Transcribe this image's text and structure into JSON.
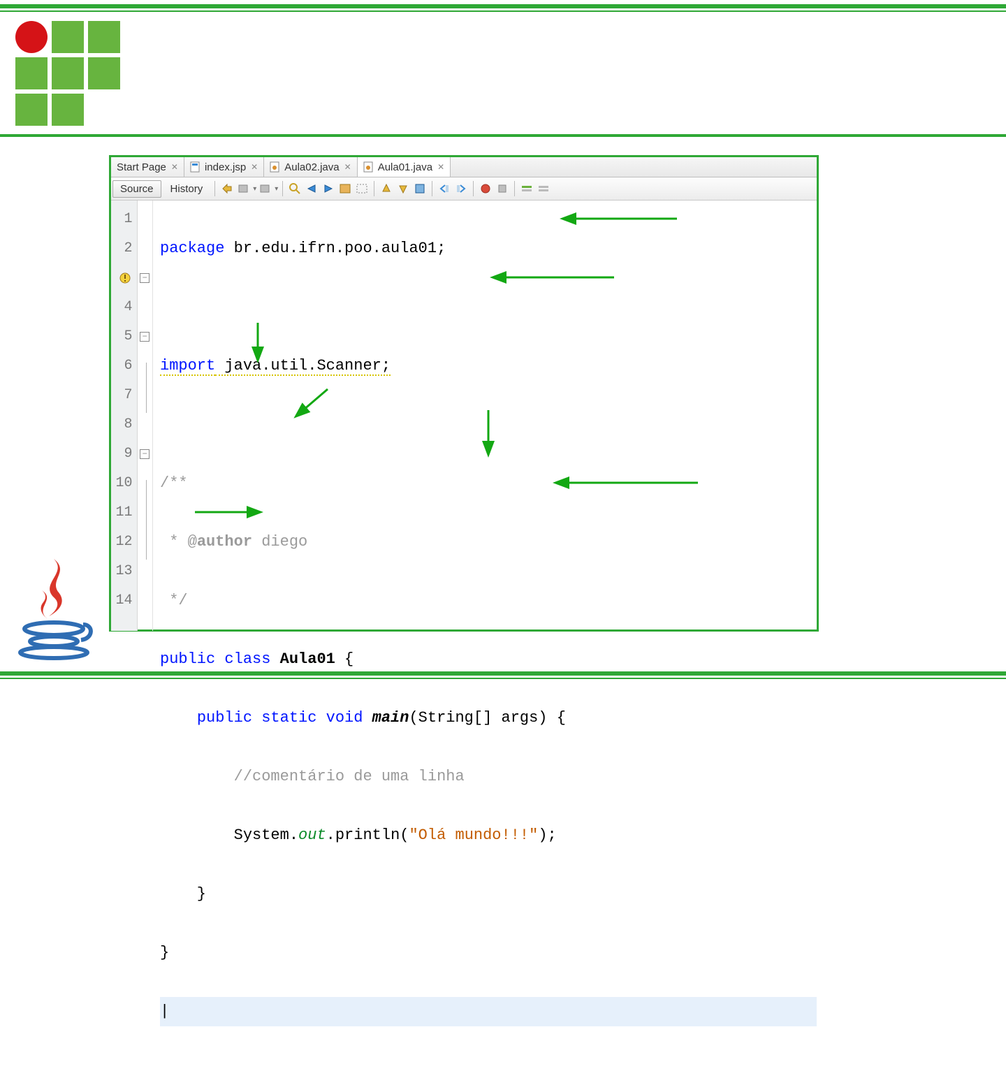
{
  "tabs": [
    {
      "label": "Start Page",
      "active": false,
      "icon": "none"
    },
    {
      "label": "index.jsp",
      "active": false,
      "icon": "jsp"
    },
    {
      "label": "Aula02.java",
      "active": false,
      "icon": "java"
    },
    {
      "label": "Aula01.java",
      "active": true,
      "icon": "java"
    }
  ],
  "toolbar": {
    "source": "Source",
    "history": "History"
  },
  "gutter": [
    "1",
    "2",
    "",
    "4",
    "5",
    "6",
    "7",
    "8",
    "9",
    "10",
    "11",
    "12",
    "13",
    "14"
  ],
  "code": {
    "l1_kw": "package",
    "l1_rest": " br.edu.ifrn.poo.aula01;",
    "l3_kw": "import",
    "l3_rest": " java.util.Scanner;",
    "l5": "/**",
    "l6_pre": " * @",
    "l6_author": "author",
    "l6_name": " diego",
    "l7": " */",
    "l8_kw1": "public",
    "l8_kw2": " class ",
    "l8_name": "Aula01",
    "l8_rest": " {",
    "l9_pre": "    ",
    "l9_kw": "public static void ",
    "l9_main": "main",
    "l9_rest": "(String[] args) {",
    "l10_pre": "        ",
    "l10_cmt": "//comentário de uma linha",
    "l11_pre": "        System.",
    "l11_out": "out",
    "l11_mid": ".println(",
    "l11_str": "\"Olá mundo!!!\"",
    "l11_end": ");",
    "l12": "    }",
    "l13": "}",
    "l14_cursor": "|"
  }
}
